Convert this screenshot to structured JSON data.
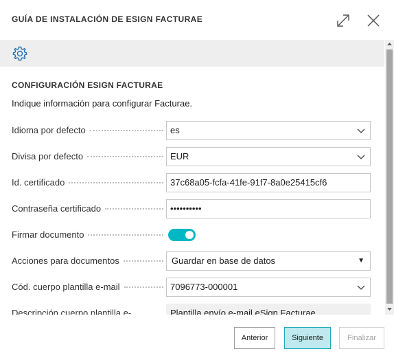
{
  "dialog": {
    "title": "GUÍA DE INSTALACIÓN DE ESIGN FACTURAE",
    "expand_icon": "expand-arrows-icon",
    "close_icon": "close-icon"
  },
  "toolbar": {
    "settings_icon": "gear-icon"
  },
  "section": {
    "title": "CONFIGURACIÓN ESIGN FACTURAE",
    "intro": "Indique información para configurar Facturae."
  },
  "fields": {
    "idioma": {
      "label": "Idioma por defecto",
      "value": "es"
    },
    "divisa": {
      "label": "Divisa por defecto",
      "value": "EUR"
    },
    "certificado": {
      "label": "Id. certificado",
      "value": "37c68a05-fcfa-41fe-91f7-8a0e25415cf6"
    },
    "contrasena": {
      "label": "Contraseña certificado",
      "value": "••••••••••"
    },
    "firmar": {
      "label": "Firmar documento",
      "checked": true
    },
    "acciones": {
      "label": "Acciones para documentos",
      "value": "Guardar en base de datos"
    },
    "cod_cuerpo": {
      "label": "Cód. cuerpo plantilla e-mail",
      "value": "7096773-000001"
    },
    "descripcion": {
      "label": "Descripción cuerpo plantilla e-",
      "value": "Plantilla envío e-mail eSign Facturae"
    }
  },
  "footer": {
    "prev_label": "Anterior",
    "next_label": "Siguiente",
    "finish_label": "Finalizar"
  },
  "colors": {
    "toggle_on": "#00b7c3",
    "primary_button_bg": "#bfe9ef",
    "primary_button_border": "#1ea8b8"
  }
}
